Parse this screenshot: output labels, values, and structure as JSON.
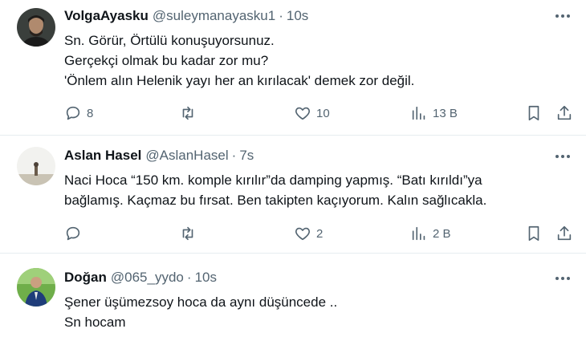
{
  "tweets": [
    {
      "name": "VolgaAyasku",
      "handle": "@suleymanayasku1",
      "time": "10s",
      "lines": [
        "Sn. Görür, Örtülü konuşuyorsunuz.",
        "Gerçekçi olmak bu kadar zor mu?",
        "'Önlem alın Helenik yayı her an kırılacak' demek zor değil."
      ],
      "replies": "8",
      "retweets": "",
      "likes": "10",
      "views": "13 B"
    },
    {
      "name": "Aslan Hasel",
      "handle": "@AslanHasel",
      "time": "7s",
      "lines": [
        "Naci Hoca “150 km. komple kırılır”da damping yapmış. “Batı kırıldı”ya",
        "bağlamış. Kaçmaz bu fırsat. Ben takipten kaçıyorum. Kalın sağlıcakla."
      ],
      "replies": "",
      "retweets": "",
      "likes": "2",
      "views": "2 B"
    },
    {
      "name": "Doğan",
      "handle": "@065_yydo",
      "time": "10s",
      "lines": [
        "Şener üşümezsoy hoca da aynı düşüncede ..",
        "Sn hocam"
      ]
    }
  ],
  "icons": {
    "reply": "reply-icon",
    "retweet": "retweet-icon",
    "like": "heart-icon",
    "views": "views-icon",
    "bookmark": "bookmark-icon",
    "share": "share-icon",
    "more": "more-icon"
  },
  "colors": {
    "text": "#0f1419",
    "secondary": "#536471",
    "divider": "#e6ecf0"
  }
}
